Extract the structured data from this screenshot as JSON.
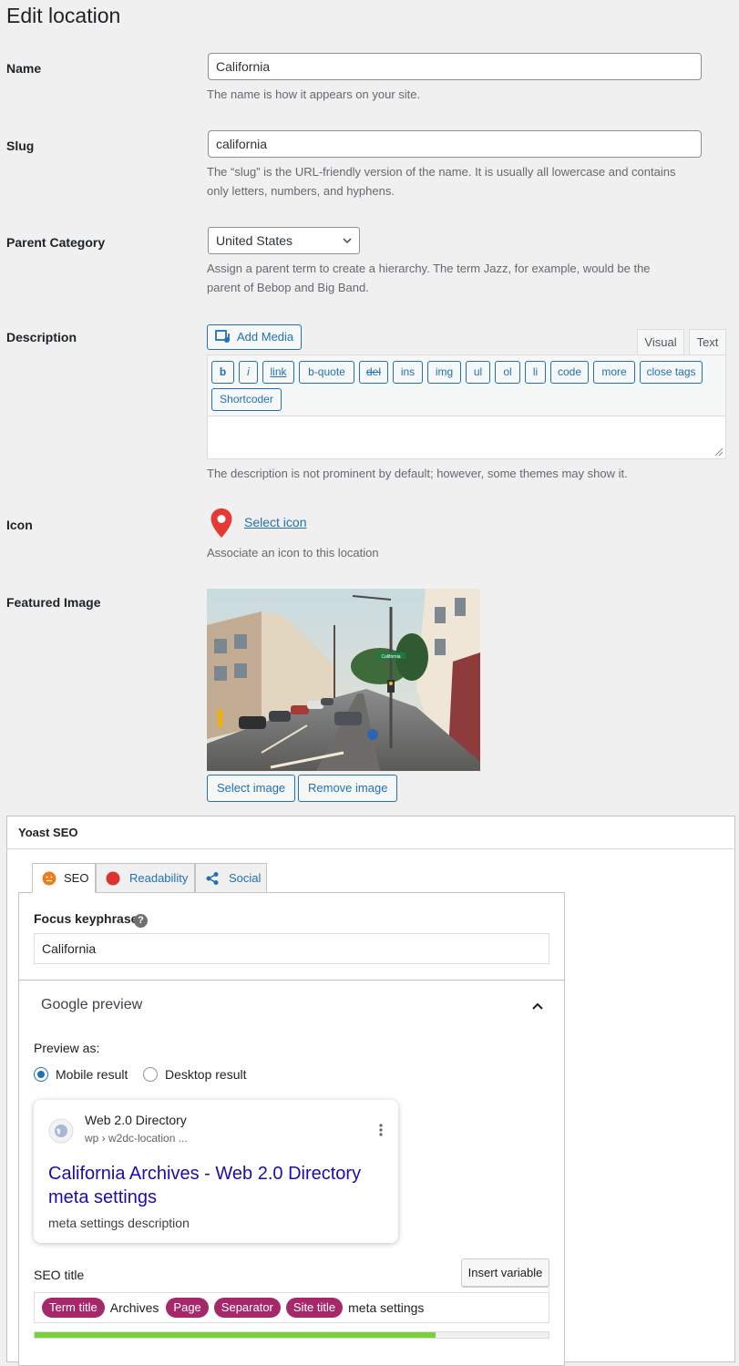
{
  "page": {
    "title": "Edit location"
  },
  "name": {
    "label": "Name",
    "value": "California",
    "help": "The name is how it appears on your site."
  },
  "slug": {
    "label": "Slug",
    "value": "california",
    "help1": "The “slug” is the URL-friendly version of the name. It is usually all lowercase and contains",
    "help2": "only letters, numbers, and hyphens."
  },
  "parent": {
    "label": "Parent Category",
    "selected": "United States",
    "help1": "Assign a parent term to create a hierarchy. The term Jazz, for example, would be the",
    "help2": "parent of Bebop and Big Band."
  },
  "description": {
    "label": "Description",
    "add_media": "Add Media",
    "tab_visual": "Visual",
    "tab_text": "Text",
    "qt_buttons": [
      "b",
      "i",
      "link",
      "b-quote",
      "del",
      "ins",
      "img",
      "ul",
      "ol",
      "li",
      "code",
      "more",
      "close tags",
      "Shortcoder"
    ],
    "help": "The description is not prominent by default; however, some themes may show it."
  },
  "icon": {
    "label": "Icon",
    "select_link": "Select icon",
    "help": "Associate an icon to this location",
    "marker_color": "#e53935"
  },
  "featured": {
    "label": "Featured Image",
    "sign_text": "California",
    "select_image": "Select image",
    "remove_image": "Remove image"
  },
  "yoast": {
    "title": "Yoast SEO",
    "tabs": {
      "seo": "SEO",
      "readability": "Readability",
      "social": "Social"
    },
    "focus_label": "Focus keyphrase",
    "focus_help_icon": "?",
    "focus_value": "California",
    "google_preview": "Google preview",
    "preview_as": "Preview as:",
    "mobile_result": "Mobile result",
    "desktop_result": "Desktop result",
    "preview_card": {
      "site_name": "Web 2.0 Directory",
      "breadcrumb": "wp › w2dc-location ...",
      "title_line1": "California Archives - Web 2.0 Directory",
      "title_line2": "meta settings",
      "description": "meta settings description"
    },
    "seo_title_label": "SEO title",
    "insert_variable": "Insert variable",
    "seo_title_parts": {
      "term_title": "Term title",
      "archives": "Archives",
      "page": "Page",
      "separator": "Separator",
      "site_title": "Site title",
      "meta_settings": "meta settings"
    },
    "progress": 0.78,
    "colors": {
      "seo_ok": "#ee7c1b",
      "readability_bad": "#dc3232",
      "progress": "#7ad03a",
      "pill": "#a4286a"
    }
  }
}
